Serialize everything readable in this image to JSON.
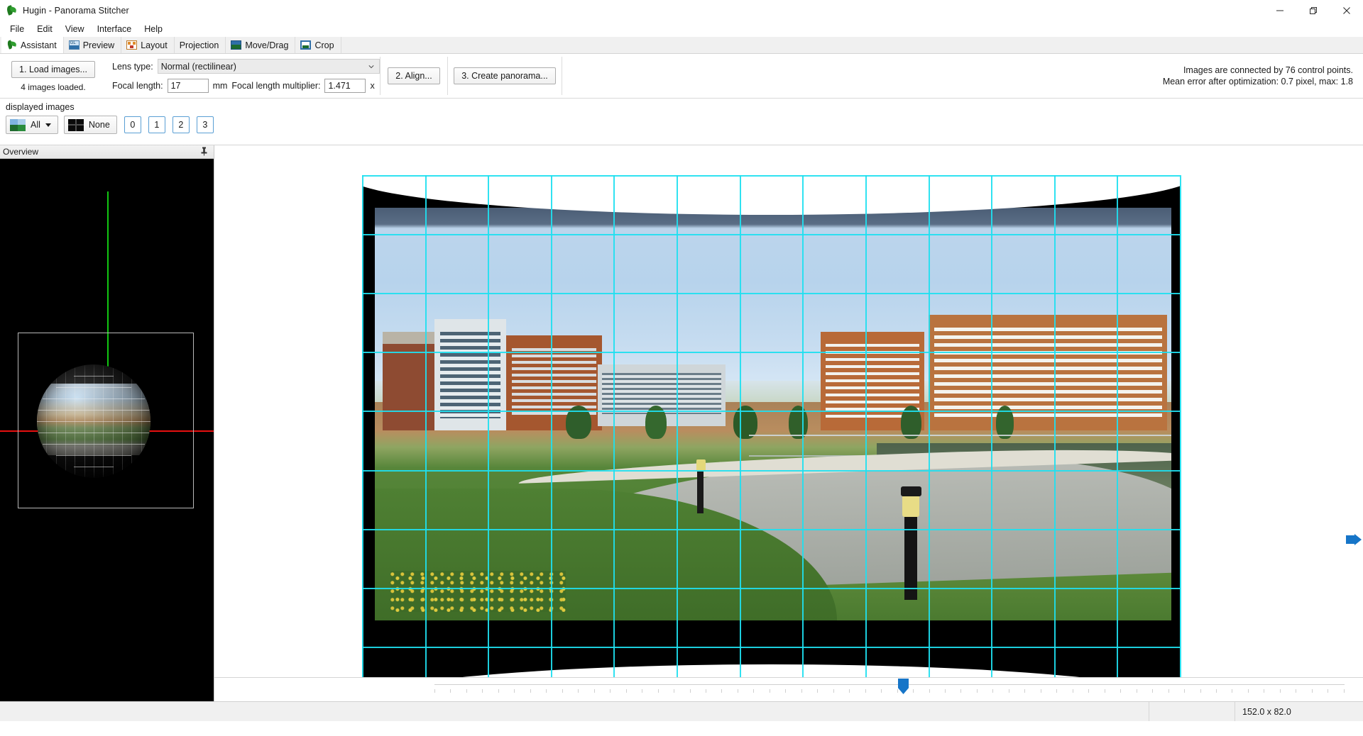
{
  "window": {
    "title": "Hugin - Panorama Stitcher",
    "icon": "hugin-leaf-icon",
    "controls": {
      "minimize": "minimize-icon",
      "maximize": "maximize-icon",
      "close": "close-icon"
    }
  },
  "menubar": {
    "items": [
      "File",
      "Edit",
      "View",
      "Interface",
      "Help"
    ]
  },
  "tabs": [
    {
      "label": "Assistant",
      "icon": "hugin-leaf-icon",
      "active": true
    },
    {
      "label": "Preview",
      "icon": "gl-preview-icon",
      "active": false
    },
    {
      "label": "Layout",
      "icon": "layout-icon",
      "active": false
    },
    {
      "label": "Projection",
      "icon": "",
      "active": false
    },
    {
      "label": "Move/Drag",
      "icon": "move-drag-icon",
      "active": false
    },
    {
      "label": "Crop",
      "icon": "crop-icon",
      "active": false
    }
  ],
  "assistant": {
    "load_images_button": "1. Load images...",
    "images_loaded_status": "4 images loaded.",
    "lens_type_label": "Lens type:",
    "lens_type_value": "Normal (rectilinear)",
    "focal_length_label": "Focal length:",
    "focal_length_value": "17",
    "focal_length_unit": "mm",
    "focal_multiplier_label": "Focal length multiplier:",
    "focal_multiplier_value": "1.471",
    "focal_multiplier_unit": "x",
    "align_button": "2. Align...",
    "create_panorama_button": "3. Create panorama...",
    "status_line_1": "Images are connected by 76 control points.",
    "status_line_2": "Mean error after optimization: 0.7 pixel, max: 1.8"
  },
  "displayed_images": {
    "caption": "displayed images",
    "all_button": "All",
    "none_button": "None",
    "image_numbers": [
      "0",
      "1",
      "2",
      "3"
    ]
  },
  "overview_dock": {
    "title": "Overview",
    "pin_icon": "pin-icon"
  },
  "statusbar": {
    "dimensions": "152.0 x 82.0"
  },
  "colors": {
    "accent_blue": "#1675c8",
    "grid_cyan": "#1ee0f0",
    "axis_red": "#e81010",
    "axis_green": "#12c512",
    "panel_gray": "#f0f0f0"
  }
}
